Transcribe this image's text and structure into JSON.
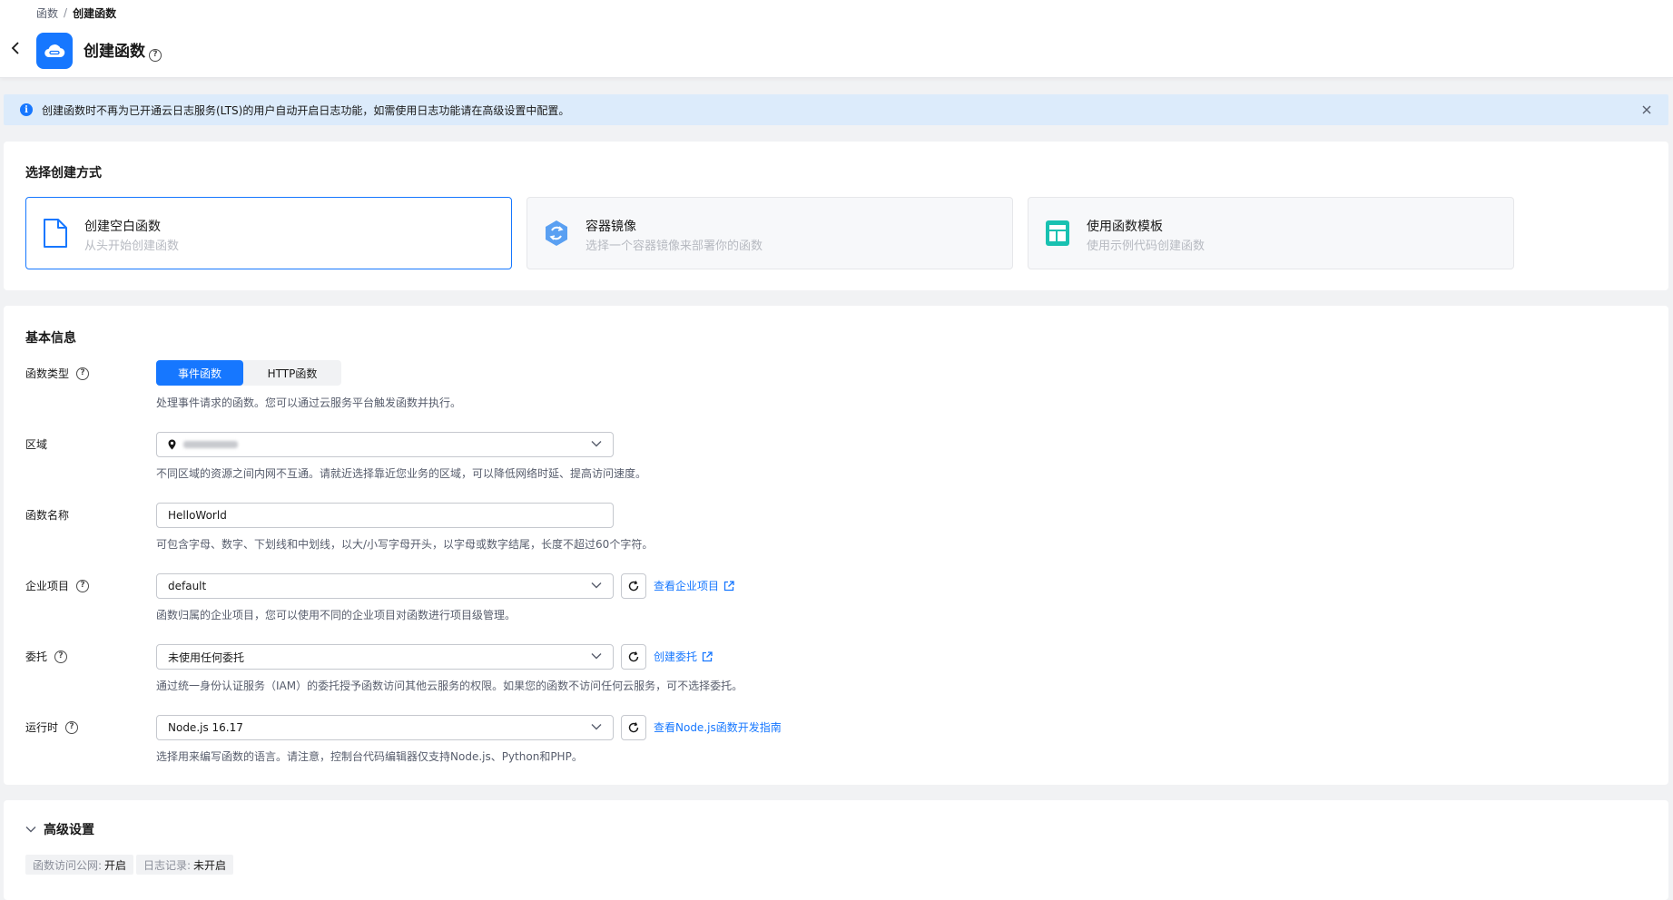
{
  "breadcrumb": {
    "parent": "函数",
    "separator": "/",
    "current": "创建函数"
  },
  "header": {
    "title": "创建函数",
    "help": "?"
  },
  "notice": {
    "text": "创建函数时不再为已开通云日志服务(LTS)的用户自动开启日志功能，如需使用日志功能请在高级设置中配置。",
    "icon": "i"
  },
  "creation": {
    "section_title": "选择创建方式",
    "methods": [
      {
        "title": "创建空白函数",
        "desc": "从头开始创建函数",
        "icon": "blank-file-icon",
        "selected": true
      },
      {
        "title": "容器镜像",
        "desc": "选择一个容器镜像来部署你的函数",
        "icon": "container-image-icon",
        "selected": false
      },
      {
        "title": "使用函数模板",
        "desc": "使用示例代码创建函数",
        "icon": "template-icon",
        "selected": false
      }
    ]
  },
  "basic": {
    "section_title": "基本信息",
    "function_type": {
      "label": "函数类型",
      "options": [
        "事件函数",
        "HTTP函数"
      ],
      "selected": "事件函数",
      "hint": "处理事件请求的函数。您可以通过云服务平台触发函数并执行。"
    },
    "region": {
      "label": "区域",
      "hint": "不同区域的资源之间内网不互通。请就近选择靠近您业务的区域，可以降低网络时延、提高访问速度。"
    },
    "function_name": {
      "label": "函数名称",
      "value": "HelloWorld",
      "hint": "可包含字母、数字、下划线和中划线，以大/小写字母开头，以字母或数字结尾，长度不超过60个字符。"
    },
    "enterprise_project": {
      "label": "企业项目",
      "value": "default",
      "link": "查看企业项目",
      "hint": "函数归属的企业项目，您可以使用不同的企业项目对函数进行项目级管理。"
    },
    "agency": {
      "label": "委托",
      "value": "未使用任何委托",
      "link": "创建委托",
      "hint": "通过统一身份认证服务（IAM）的委托授予函数访问其他云服务的权限。如果您的函数不访问任何云服务，可不选择委托。"
    },
    "runtime": {
      "label": "运行时",
      "value": "Node.js 16.17",
      "link": "查看Node.js函数开发指南",
      "hint": "选择用来编写函数的语言。请注意，控制台代码编辑器仅支持Node.js、Python和PHP。"
    }
  },
  "advanced": {
    "title": "高级设置",
    "tags": [
      {
        "key": "函数访问公网:",
        "value": "开启"
      },
      {
        "key": "日志记录:",
        "value": "未开启"
      }
    ]
  },
  "colors": {
    "primary": "#1677ff",
    "notice_bg": "#dcebfb",
    "teal": "#18c1b1"
  }
}
